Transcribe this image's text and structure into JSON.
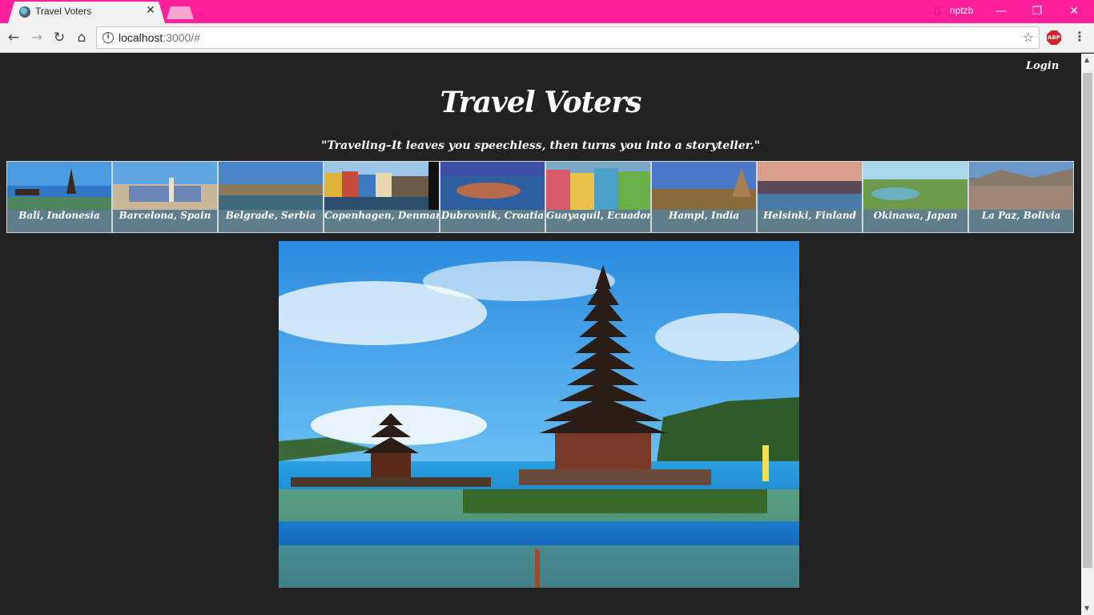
{
  "browser": {
    "tab_title": "Travel Voters",
    "tab_close": "✕",
    "profile_icon": "profile-icon",
    "profile_name": "nptzb",
    "url_host": "localhost",
    "url_path": ":3000/#",
    "window_buttons": {
      "minimize": "—",
      "restore": "❐",
      "close": "✕"
    },
    "nav": {
      "back": "←",
      "forward": "→",
      "reload": "↻",
      "home": "⌂"
    },
    "abp_label": "ABP",
    "accent_color": "#ff1f9b"
  },
  "header": {
    "login_label": "Login",
    "title": "Travel Voters",
    "quote": "\"Traveling–It leaves you speechless, then turns you into a storyteller.\""
  },
  "destinations": [
    {
      "label": "Bali, Indonesia"
    },
    {
      "label": "Barcelona, Spain"
    },
    {
      "label": "Belgrade, Serbia"
    },
    {
      "label": "Copenhagen, Denmark"
    },
    {
      "label": "Dubrovnik, Croatia"
    },
    {
      "label": "Guayaquil, Ecuador"
    },
    {
      "label": "Hampi, India"
    },
    {
      "label": "Helsinki, Finland"
    },
    {
      "label": "Okinawa, Japan"
    },
    {
      "label": "La Paz, Bolivia"
    }
  ],
  "colors": {
    "page_background": "#222222",
    "label_background": "#607d8b"
  }
}
